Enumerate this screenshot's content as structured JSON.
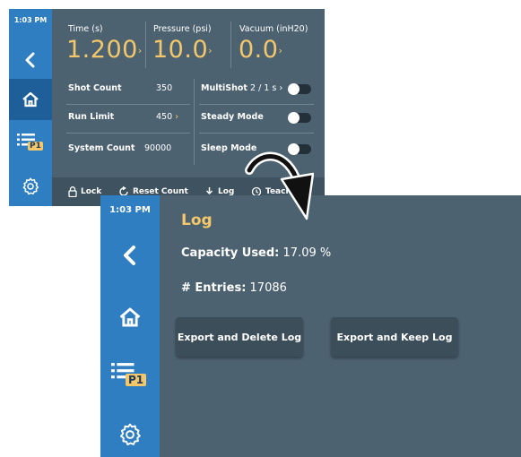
{
  "top_screen": {
    "sidebar": {
      "time": "1:03 PM"
    },
    "header": {
      "time": {
        "label": "Time (s)",
        "value": "1.200"
      },
      "pressure": {
        "label": "Pressure (psi)",
        "value": "10.0"
      },
      "vacuum": {
        "label": "Vacuum (inH20)",
        "value": "0.0"
      }
    },
    "rows": {
      "shot_count": {
        "label": "Shot Count",
        "value": "350"
      },
      "run_limit": {
        "label": "Run Limit",
        "value": "450"
      },
      "system_count": {
        "label": "System Count",
        "value": "90000"
      },
      "multishot": {
        "label": "MultiShot",
        "value": "2 / 1 s",
        "on": false
      },
      "steady_mode": {
        "label": "Steady Mode",
        "on": false
      },
      "sleep_mode": {
        "label": "Sleep Mode",
        "on": false
      }
    },
    "bottom_bar": {
      "lock": "Lock",
      "reset_count": "Reset Count",
      "log": "Log",
      "teach": "Teach"
    }
  },
  "log_screen": {
    "sidebar": {
      "time": "1:03 PM",
      "badge": "P1"
    },
    "title": "Log",
    "capacity": {
      "label": "Capacity Used:",
      "value": "17.09 %"
    },
    "entries": {
      "label": "# Entries:",
      "value": "17086"
    },
    "buttons": {
      "export_delete": "Export and Delete Log",
      "export_keep": "Export and Keep Log"
    }
  },
  "top_sidebar_badge": "P1",
  "colors": {
    "sidebar": "#2f7ec2",
    "sidebar_active": "#1f5f99",
    "panel": "#4d6271",
    "accent": "#f4c86a",
    "button": "#3d4e5b"
  },
  "icons": [
    "back-chevron-icon",
    "home-icon",
    "program-list-icon",
    "gear-icon",
    "lock-icon",
    "reset-icon",
    "download-icon",
    "history-icon",
    "curved-arrow-icon"
  ]
}
